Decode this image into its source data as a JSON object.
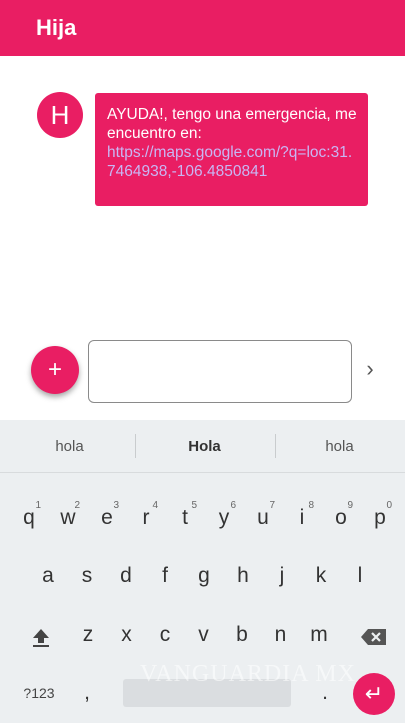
{
  "colors": {
    "accent": "#e91e63",
    "link": "#c9b6f4",
    "keyboard_bg": "#eceff1"
  },
  "header": {
    "title": "Hija"
  },
  "conversation": {
    "avatar_letter": "H",
    "message_text": "AYUDA!, tengo una emergencia, me encuentro en:",
    "message_link": "https://maps.google.com/?q=loc:31.7464938,-106.4850841"
  },
  "composer": {
    "add_icon": "+",
    "send_icon": "›",
    "input_value": ""
  },
  "keyboard": {
    "suggestions": [
      "hola",
      "Hola",
      "hola"
    ],
    "row1": [
      {
        "k": "q",
        "h": "1"
      },
      {
        "k": "w",
        "h": "2"
      },
      {
        "k": "e",
        "h": "3"
      },
      {
        "k": "r",
        "h": "4"
      },
      {
        "k": "t",
        "h": "5"
      },
      {
        "k": "y",
        "h": "6"
      },
      {
        "k": "u",
        "h": "7"
      },
      {
        "k": "i",
        "h": "8"
      },
      {
        "k": "o",
        "h": "9"
      },
      {
        "k": "p",
        "h": "0"
      }
    ],
    "row2": [
      "a",
      "s",
      "d",
      "f",
      "g",
      "h",
      "j",
      "k",
      "l"
    ],
    "row3": [
      "z",
      "x",
      "c",
      "v",
      "b",
      "n",
      "m"
    ],
    "shift_icon": "shift-icon",
    "backspace_icon": "backspace-icon",
    "symbols_label": "?123",
    "comma_label": ",",
    "period_label": ".",
    "enter_icon": "↵",
    "watermark": "VANGUARDIA MX"
  }
}
